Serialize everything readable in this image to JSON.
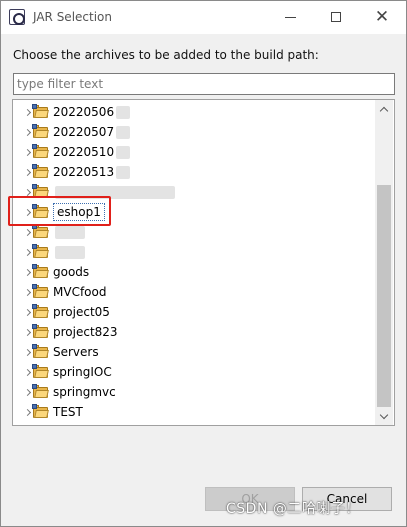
{
  "window": {
    "title": "JAR Selection"
  },
  "dialog": {
    "instructions": "Choose the archives to be added to the build path:",
    "filter_placeholder": "type filter text",
    "filter_value": ""
  },
  "tree": {
    "items": [
      {
        "label": "20220506",
        "redacted": true
      },
      {
        "label": "20220507",
        "redacted": true
      },
      {
        "label": "20220510",
        "redacted": true
      },
      {
        "label": "20220513",
        "redacted": true
      },
      {
        "label": "",
        "redacted": true
      },
      {
        "label": "eshop1",
        "selected": true
      },
      {
        "label": "",
        "redacted": true
      },
      {
        "label": "",
        "redacted": true
      },
      {
        "label": "goods"
      },
      {
        "label": "MVCfood"
      },
      {
        "label": "project05"
      },
      {
        "label": "project823"
      },
      {
        "label": "Servers"
      },
      {
        "label": "springIOC"
      },
      {
        "label": "springmvc"
      },
      {
        "label": "TEST"
      }
    ]
  },
  "buttons": {
    "ok": "OK",
    "cancel": "Cancel"
  },
  "watermark": "CSDN @二哈喇子！",
  "colors": {
    "highlight": "#e0201a",
    "folder": "#e8b54a"
  }
}
